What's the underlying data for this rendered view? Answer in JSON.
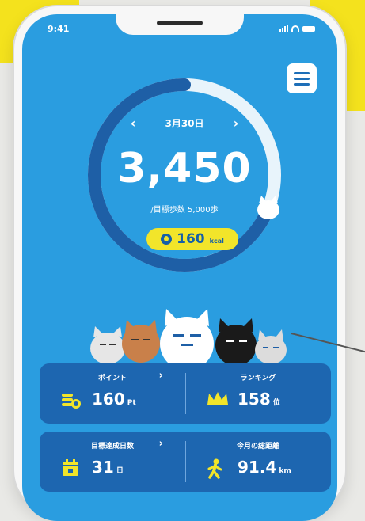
{
  "status_bar": {
    "time": "9:41"
  },
  "header": {
    "menu_icon": "hamburger-menu-icon"
  },
  "step_ring": {
    "date": "3月30日",
    "prev_icon": "chevron-left-icon",
    "next_icon": "chevron-right-icon",
    "steps": "3,450",
    "goal_text": "/目標歩数 5,000歩",
    "progress_fraction": 0.69,
    "kcal_value": "160",
    "kcal_unit": "kcal"
  },
  "stats": {
    "points": {
      "title": "ポイント",
      "value": "160",
      "unit": "Pt",
      "icon": "coins-icon"
    },
    "ranking": {
      "title": "ランキング",
      "value": "158",
      "unit": "位",
      "icon": "crown-icon"
    },
    "goal_days": {
      "title": "目標達成日数",
      "value": "31",
      "unit": "日",
      "icon": "calendar-icon"
    },
    "distance": {
      "title": "今月の総距離",
      "value": "91.4",
      "unit": "km",
      "icon": "walking-person-icon"
    }
  },
  "colors": {
    "screen_bg": "#2a9de0",
    "ring_track": "#e8f4fb",
    "ring_progress": "#1e5fa6",
    "card_bg": "#1d66b0",
    "accent_yellow": "#f2e52a"
  }
}
